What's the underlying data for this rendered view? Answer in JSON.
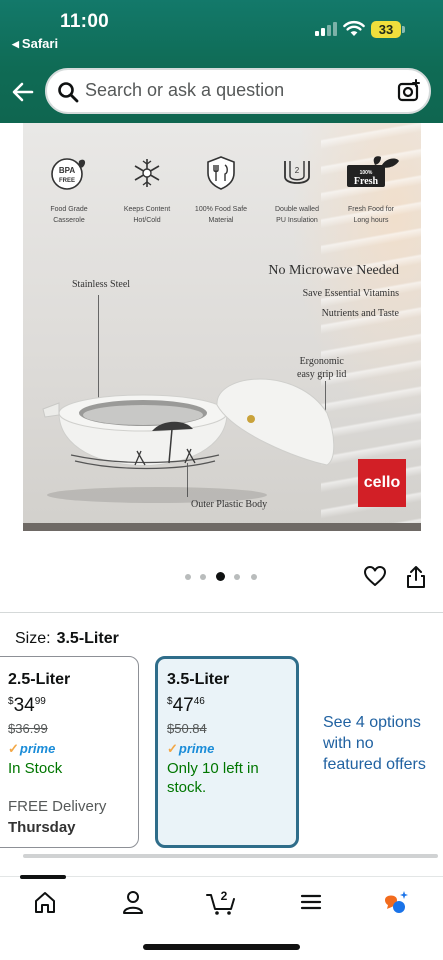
{
  "status_bar": {
    "time": "11:00",
    "back_app": "Safari",
    "battery": "33"
  },
  "search": {
    "placeholder": "Search or ask a question"
  },
  "product_image": {
    "features": [
      {
        "badge": "BPA FREE",
        "label_line1": "Food Grade",
        "label_line2": "Casserole"
      },
      {
        "badge": "",
        "label_line1": "Keeps Content",
        "label_line2": "Hot/Cold"
      },
      {
        "badge": "",
        "label_line1": "100% Food Safe",
        "label_line2": "Material"
      },
      {
        "badge": "2",
        "label_line1": "Double walled",
        "label_line2": "PU Insulation"
      },
      {
        "badge": "100% Fresh",
        "label_line1": "Fresh Food for",
        "label_line2": "Long hours"
      }
    ],
    "headline": "No Microwave Needed",
    "subline1": "Save Essential Vitamins",
    "subline2": "Nutrients and Taste",
    "callout_steel": "Stainless Steel",
    "callout_lid_line1": "Ergonomic",
    "callout_lid_line2": "easy grip lid",
    "callout_body": "Outer Plastic Body",
    "brand": "cello"
  },
  "carousel": {
    "count": 5,
    "active_index": 2
  },
  "size": {
    "label": "Size:",
    "selected": "3.5-Liter",
    "options": [
      {
        "name": "2.5-Liter",
        "price_currency": "$",
        "price_whole": "34",
        "price_fraction": "99",
        "list_price": "$36.99",
        "prime": "prime",
        "stock": "In Stock",
        "delivery_prefix": "FREE Delivery",
        "delivery_day": "Thursday"
      },
      {
        "name": "3.5-Liter",
        "price_currency": "$",
        "price_whole": "47",
        "price_fraction": "46",
        "list_price": "$50.84",
        "prime": "prime",
        "stock": "Only 10 left in stock."
      }
    ],
    "see_more": "See 4 options with no featured offers"
  },
  "tabbar": {
    "cart_count": "2",
    "tabs": [
      "home-icon",
      "account-icon",
      "cart-icon",
      "menu-icon",
      "rufus-icon"
    ]
  },
  "colors": {
    "header": "#0f6b55",
    "link": "#2162a1",
    "in_stock": "#007600",
    "prime": "#1a8cd8",
    "selected_border": "#2f6d8a"
  }
}
